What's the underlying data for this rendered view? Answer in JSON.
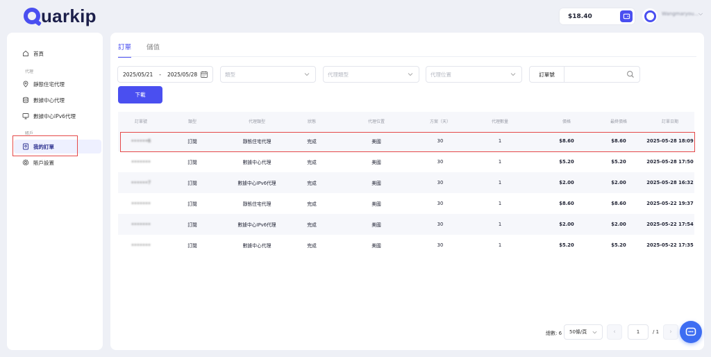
{
  "brand": {
    "logo_text": "uarkip"
  },
  "header": {
    "balance": "$18.40",
    "username": "Wangmaryou..."
  },
  "sidebar": {
    "home": "首頁",
    "group_proxy": "代理",
    "static_residential": "靜態住宅代理",
    "datacenter": "數據中心代理",
    "datacenter_ipv6": "數據中心IPv6代理",
    "group_account": "賬戶",
    "my_orders": "我的訂單",
    "account_settings": "賬戶設置"
  },
  "tabs": [
    {
      "label": "訂單"
    },
    {
      "label": "儲值"
    }
  ],
  "filters": {
    "date_start": "2025/05/21",
    "date_sep": "-",
    "date_end": "2025/05/28",
    "type_placeholder": "類型",
    "proxy_type_placeholder": "代理類型",
    "proxy_location_placeholder": "代理位置",
    "order_no_label": "訂單號"
  },
  "download_label": "下載",
  "table": {
    "headers": [
      "訂單號",
      "類型",
      "代理類型",
      "狀態",
      "代理位置",
      "方案（天）",
      "代理數量",
      "價格",
      "最終價格",
      "訂單日期"
    ],
    "rows": [
      [
        "••••••6",
        "訂閱",
        "靜態住宅代理",
        "完成",
        "美國",
        "30",
        "1",
        "$8.60",
        "$8.60",
        "2025-05-28 18:09"
      ],
      [
        "•••••••",
        "訂閱",
        "數據中心代理",
        "完成",
        "美國",
        "30",
        "1",
        "$5.20",
        "$5.20",
        "2025-05-28 17:50"
      ],
      [
        "••••••7",
        "訂閱",
        "數據中心IPv6代理",
        "完成",
        "美國",
        "30",
        "1",
        "$2.00",
        "$2.00",
        "2025-05-28 16:32"
      ],
      [
        "•••••••",
        "訂閱",
        "靜態住宅代理",
        "完成",
        "美國",
        "30",
        "1",
        "$8.60",
        "$8.60",
        "2025-05-22 19:37"
      ],
      [
        "•••••••",
        "訂閱",
        "數據中心IPv6代理",
        "完成",
        "美國",
        "30",
        "1",
        "$2.00",
        "$2.00",
        "2025-05-22 17:54"
      ],
      [
        "•••••••",
        "訂閱",
        "數據中心代理",
        "完成",
        "美國",
        "30",
        "1",
        "$5.20",
        "$5.20",
        "2025-05-22 17:35"
      ]
    ]
  },
  "pagination": {
    "total": "總數: 6",
    "per_page": "50條/頁",
    "prev": "‹",
    "current": "1",
    "of": "/ 1",
    "next": "›"
  },
  "colors": {
    "accent": "#4a4ff0",
    "highlight": "#e54848"
  }
}
